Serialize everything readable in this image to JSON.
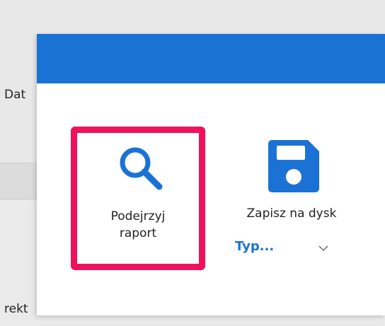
{
  "background": {
    "label_top": "Dat",
    "label_bottom": "rekt"
  },
  "dialog": {
    "header_color": "#1a73d4",
    "preview_button": {
      "label_line1": "Podejrzyj",
      "label_line2": "raport",
      "icon": "search-icon",
      "highlight_color": "#f0115c"
    },
    "save_button": {
      "label": "Zapisz na dysk",
      "icon": "floppy-disk-icon"
    },
    "type_select": {
      "value": "Typ...",
      "icon": "chevron-down-icon"
    }
  },
  "colors": {
    "accent": "#1a73d4",
    "highlight": "#f0115c"
  }
}
